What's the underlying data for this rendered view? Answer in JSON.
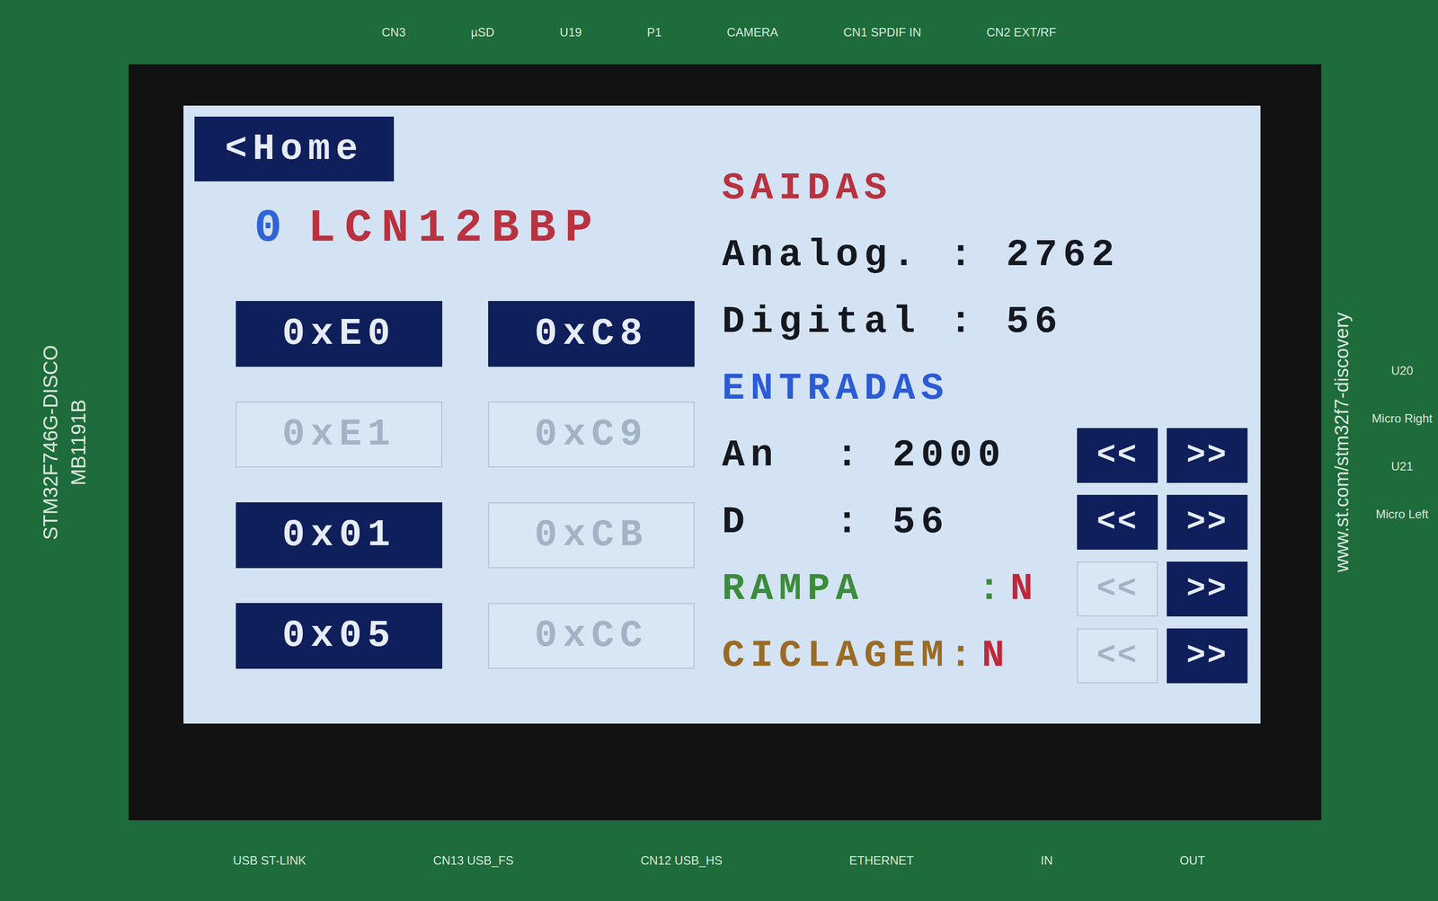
{
  "board": {
    "name": "STM32F746G-DISCO",
    "model": "MB1191B",
    "url": "www.st.com/stm32f7-discovery",
    "top_labels": [
      "CN3",
      "µSD",
      "U19",
      "P1",
      "CAMERA",
      "CN1 SPDIF IN",
      "CN2 EXT/RF"
    ],
    "side_labels": [
      "U20",
      "Micro Right",
      "U21",
      "Micro Left"
    ],
    "bottom_labels": [
      "USB ST-LINK",
      "CN13 USB_FS",
      "CN12 USB_HS",
      "ETHERNET",
      "IN",
      "OUT"
    ]
  },
  "screen": {
    "home_button": "<Home",
    "device": {
      "index": "0",
      "name": "LCN12BBP"
    },
    "registers": [
      {
        "label": "0xE0",
        "enabled": true
      },
      {
        "label": "0xC8",
        "enabled": true
      },
      {
        "label": "0xE1",
        "enabled": false
      },
      {
        "label": "0xC9",
        "enabled": false
      },
      {
        "label": "0x01",
        "enabled": true
      },
      {
        "label": "0xCB",
        "enabled": false
      },
      {
        "label": "0x05",
        "enabled": true
      },
      {
        "label": "0xCC",
        "enabled": false
      }
    ],
    "rows": [
      {
        "kind": "heading",
        "text": "SAIDAS",
        "color": "#b8323f"
      },
      {
        "kind": "reading",
        "text": "Analog. : 2762"
      },
      {
        "kind": "reading",
        "text": "Digital : 56"
      },
      {
        "kind": "heading",
        "text": "ENTRADAS",
        "color": "#2c5bd6"
      },
      {
        "kind": "control",
        "text": "An  : 2000",
        "prev": {
          "label": "<<",
          "enabled": true
        },
        "next": {
          "label": ">>",
          "enabled": true
        }
      },
      {
        "kind": "control",
        "text": "D   : 56",
        "prev": {
          "label": "<<",
          "enabled": true
        },
        "next": {
          "label": ">>",
          "enabled": true
        }
      },
      {
        "kind": "toggle",
        "text": "RAMPA    :",
        "value": "N",
        "color": "#3c8c3c",
        "prev": {
          "label": "<<",
          "enabled": false
        },
        "next": {
          "label": ">>",
          "enabled": true
        }
      },
      {
        "kind": "toggle",
        "text": "CICLAGEM:",
        "value": "N",
        "color": "#9a6b25",
        "prev": {
          "label": "<<",
          "enabled": false
        },
        "next": {
          "label": ">>",
          "enabled": true
        }
      }
    ]
  }
}
